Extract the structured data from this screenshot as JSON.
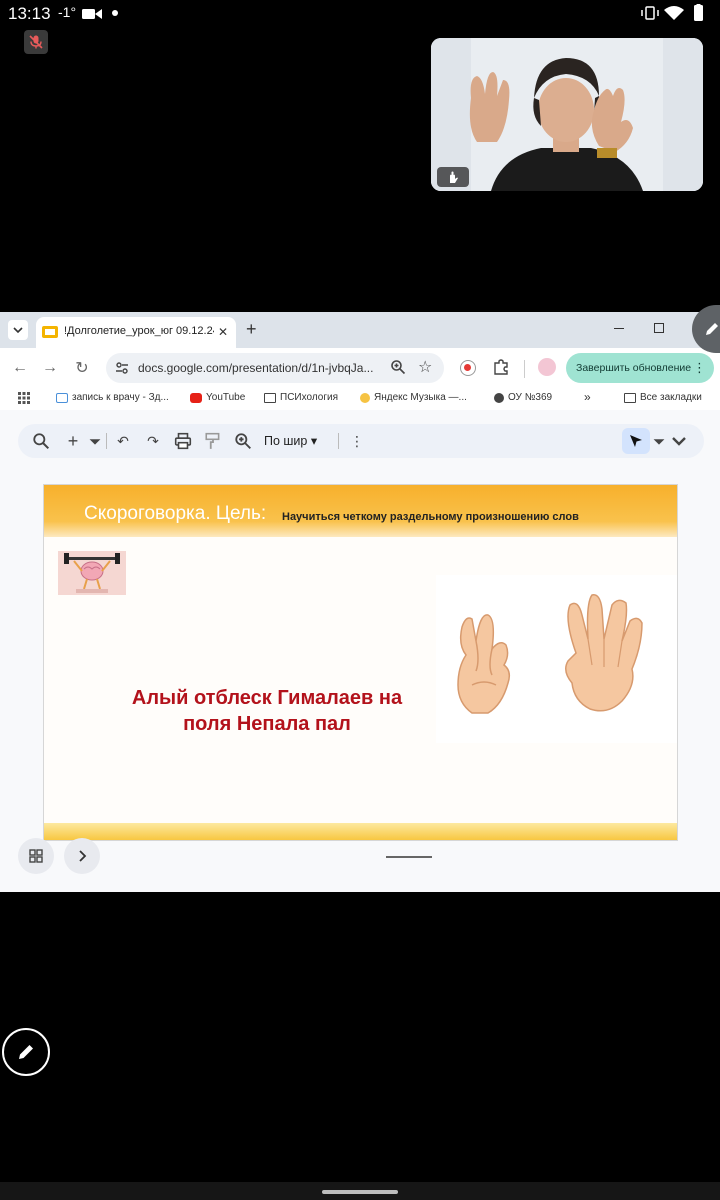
{
  "status_bar": {
    "time": "13:13",
    "temperature": "-1°",
    "icons": [
      "video-camera-icon",
      "notification-dot-icon",
      "vibrate-icon",
      "wifi-icon",
      "battery-icon"
    ]
  },
  "meeting": {
    "mic_state_icon": "mic-off-icon",
    "participant_tile_icon": "raise-hand-icon"
  },
  "browser": {
    "tab": {
      "title": "!Долголетие_урок_юг 09.12.24",
      "icon": "google-slides-icon"
    },
    "address": {
      "url": "docs.google.com/presentation/d/1n-jvbqJa..."
    },
    "update_button_label": "Завершить обновление",
    "bookmarks": [
      {
        "label": "запись к врачу - Зд...",
        "icon": "gosuslugi-icon"
      },
      {
        "label": "YouTube",
        "icon": "youtube-icon"
      },
      {
        "label": "ПСИхология",
        "icon": "folder-icon"
      },
      {
        "label": "Яндекс Музыка —...",
        "icon": "yandex-music-icon"
      },
      {
        "label": "ОУ №369",
        "icon": "globe-icon"
      }
    ],
    "more_bookmarks": "»",
    "all_bookmarks": "Все закладки"
  },
  "slides_toolbar": {
    "zoom_label": "По шир"
  },
  "slide": {
    "title": "Скороговорка. Цель:",
    "goal": "Научиться четкому раздельному произношению слов",
    "text_line1": "Алый отблеск Гималаев на",
    "text_line2": "поля Непала пал",
    "images": [
      "brain-weightlifting-image",
      "crossed-fingers-emoji",
      "vulcan-salute-emoji"
    ]
  },
  "colors": {
    "accent_update": "#9fe3d2",
    "banner_orange": "#f7b02c",
    "slide_text_red": "#b3121b"
  }
}
